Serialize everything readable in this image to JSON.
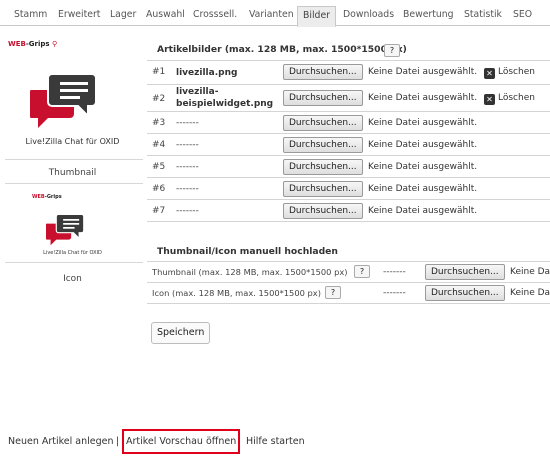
{
  "tabs": [
    "Stamm",
    "Erweitert",
    "Lager",
    "Auswahl",
    "Crosssell.",
    "Varianten",
    "Bilder",
    "Downloads",
    "Bewertung",
    "Statistik",
    "SEO"
  ],
  "active_tab": "Bilder",
  "brand": {
    "web": "WEB",
    "grips": "-Grips"
  },
  "left": {
    "caption_large": "Live!Zilla Chat für OXID",
    "caption_small": "Live!Zilla Chat für OXID",
    "thumbnail_label": "Thumbnail",
    "icon_label": "Icon"
  },
  "section_images": {
    "title": "Artikelbilder (max. 128 MB, max. 1500*1500 px)",
    "help": "?"
  },
  "image_rows": [
    {
      "num": "#1",
      "file": "livezilla.png",
      "browse": "Durchsuchen...",
      "status": "Keine Datei ausgewählt.",
      "delete": "Löschen"
    },
    {
      "num": "#2",
      "file": "livezilla-\nbeispielwidget.png",
      "browse": "Durchsuchen...",
      "status": "Keine Datei ausgewählt.",
      "delete": "Löschen"
    },
    {
      "num": "#3",
      "file": "-------",
      "browse": "Durchsuchen...",
      "status": "Keine Datei ausgewählt."
    },
    {
      "num": "#4",
      "file": "-------",
      "browse": "Durchsuchen...",
      "status": "Keine Datei ausgewählt."
    },
    {
      "num": "#5",
      "file": "-------",
      "browse": "Durchsuchen...",
      "status": "Keine Datei ausgewählt."
    },
    {
      "num": "#6",
      "file": "-------",
      "browse": "Durchsuchen...",
      "status": "Keine Datei ausgewählt."
    },
    {
      "num": "#7",
      "file": "-------",
      "browse": "Durchsuchen...",
      "status": "Keine Datei ausgewählt."
    }
  ],
  "section_manual": {
    "title": "Thumbnail/Icon manuell hochladen"
  },
  "manual_rows": [
    {
      "label": "Thumbnail (max. 128 MB, max. 1500*1500 px)",
      "help": "?",
      "file": "-------",
      "browse": "Durchsuchen...",
      "status": "Keine Da"
    },
    {
      "label": "Icon (max. 128 MB, max. 1500*1500 px)",
      "help": "?",
      "file": "-------",
      "browse": "Durchsuchen...",
      "status": "Keine Da"
    }
  ],
  "save_label": "Speichern",
  "footer": {
    "new_article": "Neuen Artikel anlegen",
    "separator": "|",
    "preview": "Artikel Vorschau öffnen",
    "help": "Hilfe starten"
  },
  "colors": {
    "highlight": "#e0001b",
    "brand_red": "#c8102e",
    "logo_red": "#c8102e",
    "logo_dark": "#3a3a3a"
  }
}
